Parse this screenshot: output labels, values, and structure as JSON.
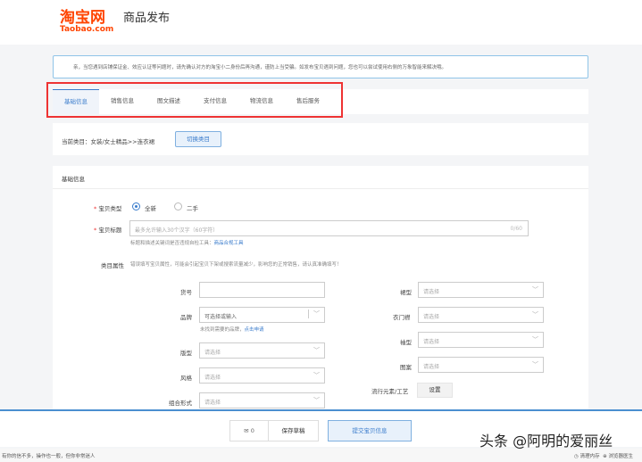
{
  "header": {
    "logo_cn": "淘宝网",
    "logo_en": "Taobao.com",
    "title": "商品发布"
  },
  "notice": "亲，当您遇到店铺保证金、效应认证等问题时，请先确认对方的淘宝小二身份后再沟通，谨防上当受骗。如发布宝贝遇到问题，您也可以尝试使用右侧的万象智能来解决哦。",
  "tabs": [
    "基础信息",
    "销售信息",
    "图文描述",
    "支付信息",
    "物流信息",
    "售后服务"
  ],
  "category": {
    "text": "当前类目：女装/女士精品>>连衣裙",
    "switch": "切换类目"
  },
  "section": "基础信息",
  "form": {
    "type_label": "宝贝类型",
    "type_new": "全新",
    "type_used": "二手",
    "title_label": "宝贝标题",
    "title_placeholder": "最多允许输入30个汉字（60字符）",
    "title_count": "0/60",
    "title_hint": "标题和描述关键词是否违规自检工具：",
    "title_hint_link": "商品合规工具",
    "attr_label": "类目属性",
    "attr_hint": "错误填写宝贝属性，可能会引起宝贝下架或搜索流量减少，影响您的正常销售，请认真准确填写！",
    "item_no": "货号",
    "brand": "品牌",
    "brand_placeholder": "可选择或输入",
    "brand_hint": "未找到需要的品牌，",
    "brand_link": "点击申请",
    "fit": "版型",
    "style": "风格",
    "combo": "组合形式",
    "select": "请选择",
    "skirt": "裙型",
    "placket": "衣门襟",
    "sleeve": "袖型",
    "pattern": "图案",
    "trend": "流行元素/工艺",
    "set": "设置"
  },
  "footer": {
    "draft_count": "0",
    "save": "保存草稿",
    "submit": "提交宝贝信息"
  },
  "watermark": "头条 @阿明的爱丽丝",
  "status": {
    "left": "有你的信不多，操作也一般，但你非常迷人",
    "clean": "清理内存",
    "doctor": "浏览器医生"
  }
}
